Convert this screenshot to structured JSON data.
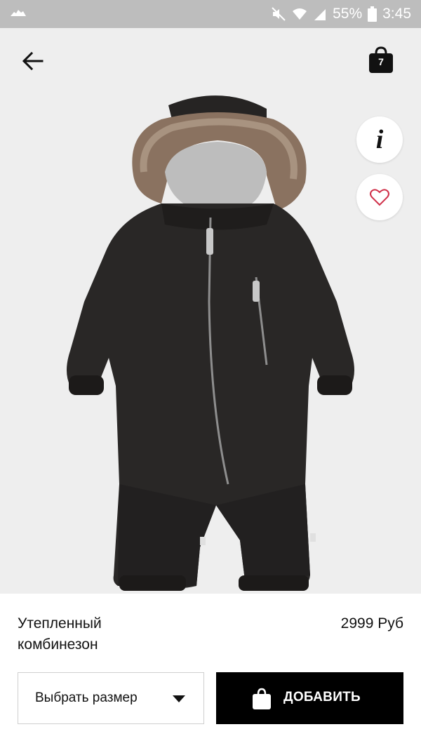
{
  "status_bar": {
    "battery_percent": "55%",
    "time": "3:45",
    "icons": [
      "cloud-icon",
      "mute-icon",
      "wifi-icon",
      "signal-icon",
      "battery-icon"
    ]
  },
  "header": {
    "back_icon": "arrow-left-icon",
    "bag_icon": "shopping-bag-icon",
    "bag_count": "7"
  },
  "actions": {
    "info_label": "i",
    "favorite_icon": "heart-icon"
  },
  "product": {
    "name": "Утепленный комбинезон",
    "price": "2999 Руб"
  },
  "size_select": {
    "label": "Выбрать размер",
    "icon": "chevron-down-icon"
  },
  "add_button": {
    "label": "ДОБАВИТЬ",
    "icon": "shopping-bag-icon"
  },
  "colors": {
    "accent": "#000000",
    "hero_background": "#eeeeee",
    "favorite": "#d0314a"
  }
}
